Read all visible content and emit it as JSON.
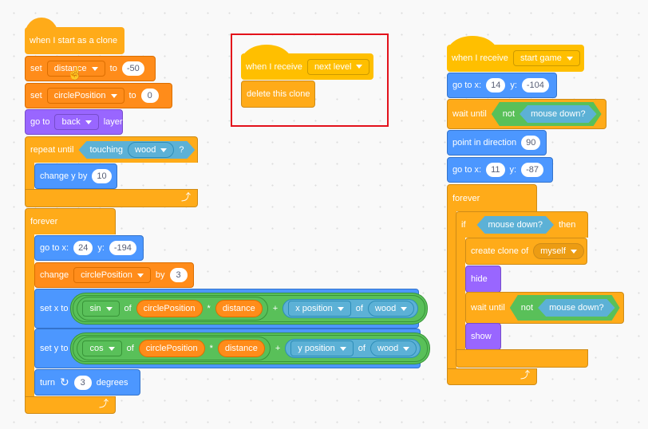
{
  "colors": {
    "events": "#ffbf00",
    "control": "#ffab19",
    "variables": "#ff8c1a",
    "motion": "#4c97ff",
    "looks": "#9966ff",
    "operators": "#59c059",
    "sensing": "#5cb1d6",
    "highlight": "#e3111b"
  },
  "script1": {
    "hat": "when I start as a clone",
    "set1": {
      "label": "set",
      "var": "distance",
      "to": "to",
      "value": "-50"
    },
    "set2": {
      "label": "set",
      "var": "circlePosition",
      "to": "to",
      "value": "0"
    },
    "goto_layer": {
      "label": "go to",
      "option": "back",
      "suffix": "layer"
    },
    "repeat_until": {
      "label": "repeat until",
      "touching": "touching",
      "object": "wood",
      "q": "?"
    },
    "change_y": {
      "label": "change y by",
      "value": "10"
    },
    "forever": "forever",
    "goto_xy": {
      "label": "go to x:",
      "x": "24",
      "ylabel": "y:",
      "y": "-194"
    },
    "change_var": {
      "label": "change",
      "var": "circlePosition",
      "by": "by",
      "value": "3"
    },
    "set_x": {
      "label": "set x to",
      "fn": "sin",
      "of": "of",
      "arg": "circlePosition",
      "mul": "*",
      "factor": "distance",
      "plus": "+",
      "prop": "x position",
      "of2": "of",
      "obj": "wood"
    },
    "set_y": {
      "label": "set y to",
      "fn": "cos",
      "of": "of",
      "arg": "circlePosition",
      "mul": "*",
      "factor": "distance",
      "plus": "+",
      "prop": "y position",
      "of2": "of",
      "obj": "wood"
    },
    "turn": {
      "label": "turn",
      "value": "3",
      "suffix": "degrees"
    }
  },
  "script2": {
    "hat": {
      "label": "when I receive",
      "message": "next level"
    },
    "delete": "delete this clone"
  },
  "script3": {
    "hat": {
      "label": "when I receive",
      "message": "start game"
    },
    "goto1": {
      "label": "go to x:",
      "x": "14",
      "ylabel": "y:",
      "y": "-104"
    },
    "wait1": {
      "label": "wait until",
      "not": "not",
      "cond": "mouse down?"
    },
    "point": {
      "label": "point in direction",
      "value": "90"
    },
    "goto2": {
      "label": "go to x:",
      "x": "11",
      "ylabel": "y:",
      "y": "-87"
    },
    "forever": "forever",
    "if": {
      "label": "if",
      "cond": "mouse down?",
      "then": "then"
    },
    "clone": {
      "label": "create clone of",
      "target": "myself"
    },
    "hide": "hide",
    "wait2": {
      "label": "wait until",
      "not": "not",
      "cond": "mouse down?"
    },
    "show": "show"
  }
}
